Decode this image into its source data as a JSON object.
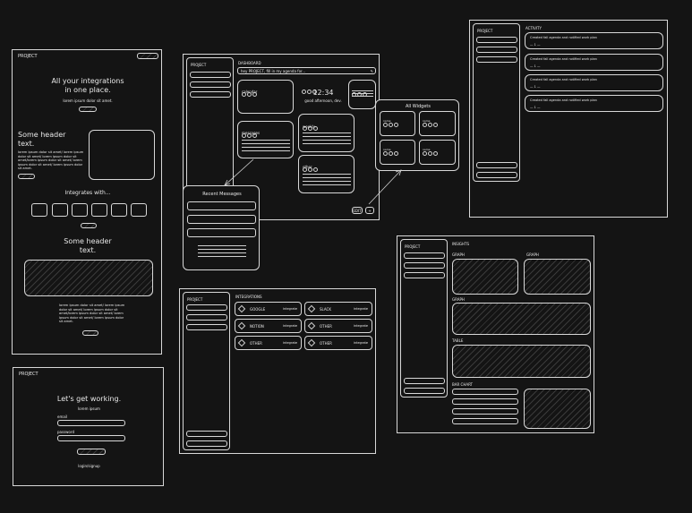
{
  "landing": {
    "logo": "PROJECT",
    "hero_title_1": "All your integrations",
    "hero_title_2": "in one place.",
    "hero_sub": "lorem ipsum dolor sit amet.",
    "header1_1": "Some header",
    "header1_2": "text.",
    "body1": [
      "lorem ipsum dolor sit amet/ lorem ipsum",
      "dolor sit amet/ lorem ipsum  dolor sit",
      "amet/lorem ipsum dolor sit amet/ lorem",
      "ipsum dolor sit amet/ lorem ipsum dolor",
      "sit amet."
    ],
    "integrates_title": "Integrates with...",
    "header2_1": "Some header",
    "header2_2": "text.",
    "body2": [
      "lorem ipsum dolor sit amet/ lorem ipsum",
      "dolor sit amet/ lorem ipsum  dolor sit",
      "amet/lorem ipsum dolor sit amet/ lorem",
      "ipsum dolor sit amet/ lorem ipsum dolor",
      "sit amet."
    ]
  },
  "login": {
    "logo": "PROJECT",
    "title": "Let's get working.",
    "sub": "lorem ipsum",
    "email_label": "email",
    "password_label": "password",
    "signup": "login/signup"
  },
  "dashboard": {
    "logo": "PROJECT",
    "title": "DASHBOARD",
    "search_value": "hey PROJECT, fill in my agenda for...",
    "widget_calendar": "calendar",
    "clock": "12:34",
    "clock_sub": "good afternoon, dev.",
    "widget_messages": "messages",
    "widget_weekly": "weekly",
    "widget_other": "other",
    "edit_button": "EDIT",
    "add_button": "+"
  },
  "recent_messages": {
    "title": "Recent Messages"
  },
  "all_widgets": {
    "title": "All Widgets",
    "item_label": "name"
  },
  "activity": {
    "logo": "PROJECT",
    "title": "ACTIVITY",
    "items": [
      {
        "text": "Created fall agenda and notified work plan",
        "meta": "— 1 —"
      },
      {
        "text": "Created fall agenda and notified work plan",
        "meta": "— 1 —"
      },
      {
        "text": "Created fall agenda and notified work plan",
        "meta": "— 1 —"
      },
      {
        "text": "Created fall agenda and notified work plan",
        "meta": "— 1 —"
      }
    ]
  },
  "integrations": {
    "logo": "PROJECT",
    "title": "INTEGRATIONS",
    "action": "integrate",
    "items": [
      {
        "name": "GOOGLE"
      },
      {
        "name": "SLACK"
      },
      {
        "name": "NOTION"
      },
      {
        "name": "OTHER"
      },
      {
        "name": "OTHER"
      },
      {
        "name": "OTHER"
      }
    ]
  },
  "insights": {
    "logo": "PROJECT",
    "title": "INSIGHTS",
    "graph1": "GRAPH",
    "graph2": "GRAPH",
    "graph3": "GRAPH",
    "table": "TABLE",
    "bar_chart": "BAR CHART"
  }
}
